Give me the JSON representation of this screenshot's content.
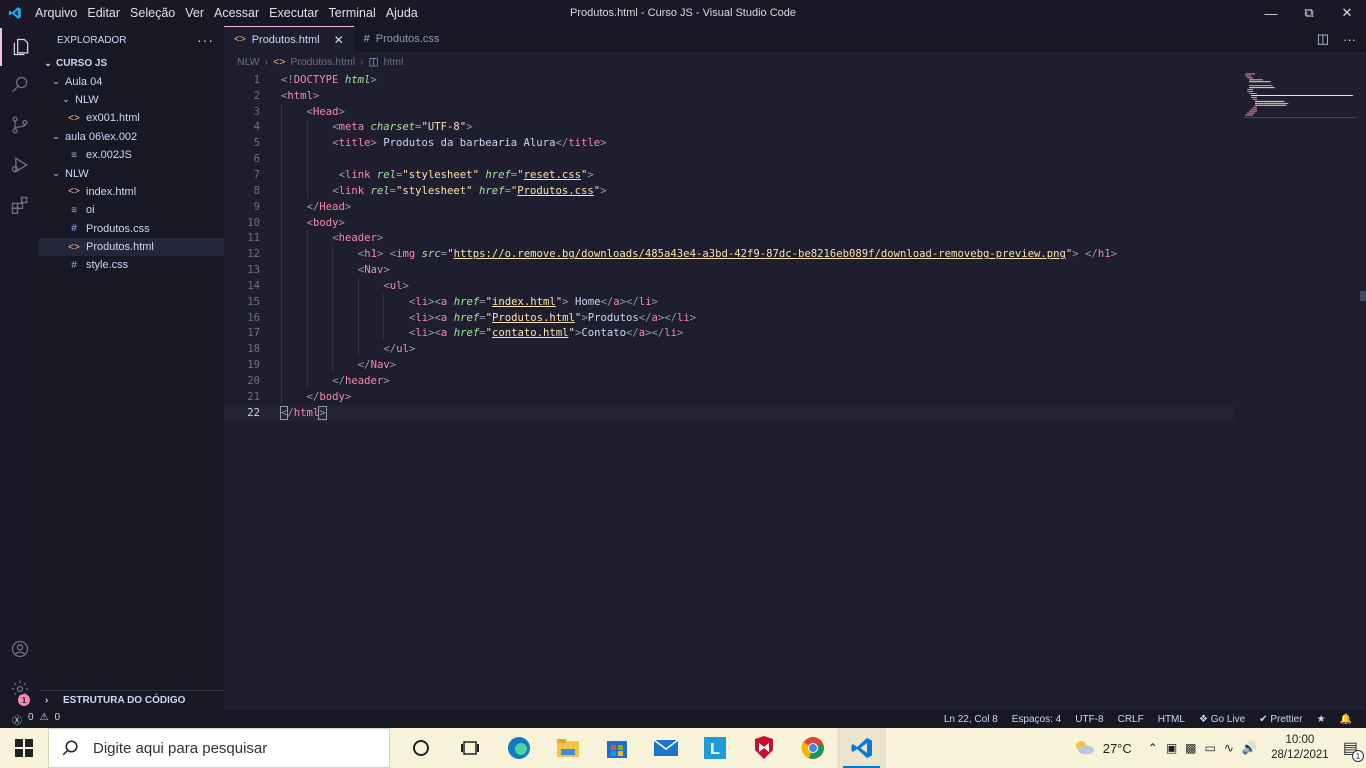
{
  "window": {
    "title": "Produtos.html - Curso JS - Visual Studio Code",
    "menu": [
      "Arquivo",
      "Editar",
      "Seleção",
      "Ver",
      "Acessar",
      "Executar",
      "Terminal",
      "Ajuda"
    ]
  },
  "sidebar": {
    "title": "EXPLORADOR",
    "root": "CURSO JS",
    "items": [
      {
        "label": "Aula  04",
        "indent": 1,
        "type": "folder",
        "open": true
      },
      {
        "label": "NLW",
        "indent": 2,
        "type": "folder",
        "open": true
      },
      {
        "label": "ex001.html",
        "indent": 2,
        "type": "html"
      },
      {
        "label": "aula 06\\ex.002",
        "indent": 1,
        "type": "folder",
        "open": true
      },
      {
        "label": "ex.002JS",
        "indent": 2,
        "type": "file"
      },
      {
        "label": "NLW",
        "indent": 1,
        "type": "folder",
        "open": true
      },
      {
        "label": "index.html",
        "indent": 2,
        "type": "html"
      },
      {
        "label": "oi",
        "indent": 2,
        "type": "file"
      },
      {
        "label": "Produtos.css",
        "indent": 2,
        "type": "css"
      },
      {
        "label": "Produtos.html",
        "indent": 2,
        "type": "html",
        "selected": true
      },
      {
        "label": "style.css",
        "indent": 2,
        "type": "css"
      }
    ],
    "outline": "ESTRUTURA DO CÓDIGO"
  },
  "tabs": [
    {
      "label": "Produtos.html",
      "active": true
    },
    {
      "label": "Produtos.css",
      "active": false
    }
  ],
  "breadcrumb": [
    "NLW",
    "Produtos.html",
    "html"
  ],
  "code": [
    {
      "n": "1",
      "i": 0,
      "h": "<span class='p'>&lt;!</span><span class='dt'>DOCTYPE</span> <span class='a'>html</span><span class='p'>&gt;</span>"
    },
    {
      "n": "2",
      "i": 0,
      "h": "<span class='p'>&lt;</span><span class='t'>html</span><span class='p'>&gt;</span>"
    },
    {
      "n": "3",
      "i": 1,
      "h": "<span class='p'>&lt;</span><span class='t'>Head</span><span class='p'>&gt;</span>"
    },
    {
      "n": "4",
      "i": 2,
      "h": "<span class='p'>&lt;</span><span class='t'>meta</span> <span class='a'>charset</span><span class='p'>=</span><span class='s'>\"UTF-8\"</span><span class='p'>&gt;</span>"
    },
    {
      "n": "5",
      "i": 2,
      "h": "<span class='p'>&lt;</span><span class='t'>title</span><span class='p'>&gt;</span><span class='x'> Produtos da barbearia Alura</span><span class='p'>&lt;/</span><span class='t'>title</span><span class='p'>&gt;</span>"
    },
    {
      "n": "6",
      "i": 2,
      "h": ""
    },
    {
      "n": "7",
      "i": 2,
      "h": " <span class='p'>&lt;</span><span class='t'>link</span> <span class='a'>rel</span><span class='p'>=</span><span class='s'>\"stylesheet\"</span> <span class='a'>href</span><span class='p'>=</span><span class='s'>\"<span class='u'>reset.css</span>\"</span><span class='p'>&gt;</span>"
    },
    {
      "n": "8",
      "i": 2,
      "h": "<span class='p'>&lt;</span><span class='t'>link</span> <span class='a'>rel</span><span class='p'>=</span><span class='s'>\"stylesheet\"</span> <span class='a'>href</span><span class='p'>=</span><span class='s'>\"<span class='u'>Produtos.css</span>\"</span><span class='p'>&gt;</span>"
    },
    {
      "n": "9",
      "i": 1,
      "h": "<span class='p'>&lt;/</span><span class='t'>Head</span><span class='p'>&gt;</span>"
    },
    {
      "n": "10",
      "i": 1,
      "h": "<span class='p'>&lt;</span><span class='t'>body</span><span class='p'>&gt;</span>"
    },
    {
      "n": "11",
      "i": 2,
      "h": "<span class='p'>&lt;</span><span class='t'>header</span><span class='p'>&gt;</span>"
    },
    {
      "n": "12",
      "i": 3,
      "h": "<span class='p'>&lt;</span><span class='t'>h1</span><span class='p'>&gt;</span> <span class='p'>&lt;</span><span class='t'>img</span> <span class='a'>src</span><span class='p'>=</span><span class='s'>\"<span class='u'>https://o.remove.bg/downloads/485a43e4-a3bd-42f9-87dc-be8216eb089f/download-removebg-preview.png</span>\"</span><span class='p'>&gt;</span> <span class='p'>&lt;/</span><span class='t'>h1</span><span class='p'>&gt;</span>"
    },
    {
      "n": "13",
      "i": 3,
      "h": "<span class='p'>&lt;</span><span class='t'>Nav</span><span class='p'>&gt;</span>"
    },
    {
      "n": "14",
      "i": 4,
      "h": "<span class='p'>&lt;</span><span class='t'>ul</span><span class='p'>&gt;</span>"
    },
    {
      "n": "15",
      "i": 5,
      "h": "<span class='p'>&lt;</span><span class='t'>li</span><span class='p'>&gt;&lt;</span><span class='t'>a</span> <span class='a'>href</span><span class='p'>=</span><span class='s'>\"<span class='u'>index.html</span>\"</span><span class='p'>&gt;</span><span class='x'> Home</span><span class='p'>&lt;/</span><span class='t'>a</span><span class='p'>&gt;&lt;/</span><span class='t'>li</span><span class='p'>&gt;</span>"
    },
    {
      "n": "16",
      "i": 5,
      "h": "<span class='p'>&lt;</span><span class='t'>li</span><span class='p'>&gt;&lt;</span><span class='t'>a</span> <span class='a'>href</span><span class='p'>=</span><span class='s'>\"<span class='u'>Produtos.html</span>\"</span><span class='p'>&gt;</span><span class='x'>Produtos</span><span class='p'>&lt;/</span><span class='t'>a</span><span class='p'>&gt;&lt;/</span><span class='t'>li</span><span class='p'>&gt;</span>"
    },
    {
      "n": "17",
      "i": 5,
      "h": "<span class='p'>&lt;</span><span class='t'>li</span><span class='p'>&gt;&lt;</span><span class='t'>a</span> <span class='a'>href</span><span class='p'>=</span><span class='s'>\"<span class='u'>contato.html</span>\"</span><span class='p'>&gt;</span><span class='x'>Contato</span><span class='p'>&lt;/</span><span class='t'>a</span><span class='p'>&gt;&lt;/</span><span class='t'>li</span><span class='p'>&gt;</span>"
    },
    {
      "n": "18",
      "i": 4,
      "h": "<span class='p'>&lt;/</span><span class='t'>ul</span><span class='p'>&gt;</span>"
    },
    {
      "n": "19",
      "i": 3,
      "h": "<span class='p'>&lt;/</span><span class='t'>Nav</span><span class='p'>&gt;</span>"
    },
    {
      "n": "20",
      "i": 2,
      "h": "<span class='p'>&lt;/</span><span class='t'>header</span><span class='p'>&gt;</span>"
    },
    {
      "n": "21",
      "i": 1,
      "h": "<span class='p'>&lt;/</span><span class='t'>body</span><span class='p'>&gt;</span>"
    },
    {
      "n": "22",
      "i": 0,
      "h": "<span class='p' style='outline:1px solid #9399b2'>&lt;</span><span class='p'>/</span><span class='t'>html</span><span class='p' style='outline:1px solid #9399b2'>&gt;</span>",
      "cur": true
    }
  ],
  "status": {
    "errors": "0",
    "warnings": "0",
    "position": "Ln 22, Col 8",
    "spaces": "Espaços: 4",
    "encoding": "UTF-8",
    "eol": "CRLF",
    "language": "HTML",
    "golive": "Go Live",
    "prettier": "Prettier"
  },
  "taskbar": {
    "search_placeholder": "Digite aqui para pesquisar",
    "temperature": "27°C",
    "time": "10:00",
    "date": "28/12/2021",
    "notif_count": "1",
    "app_letter": "L"
  },
  "colors": {
    "accent": "#f5c2e7",
    "editor_bg": "#1e1e2e",
    "sidebar_bg": "#181825",
    "taskbar_bg": "#f6f3d9"
  }
}
